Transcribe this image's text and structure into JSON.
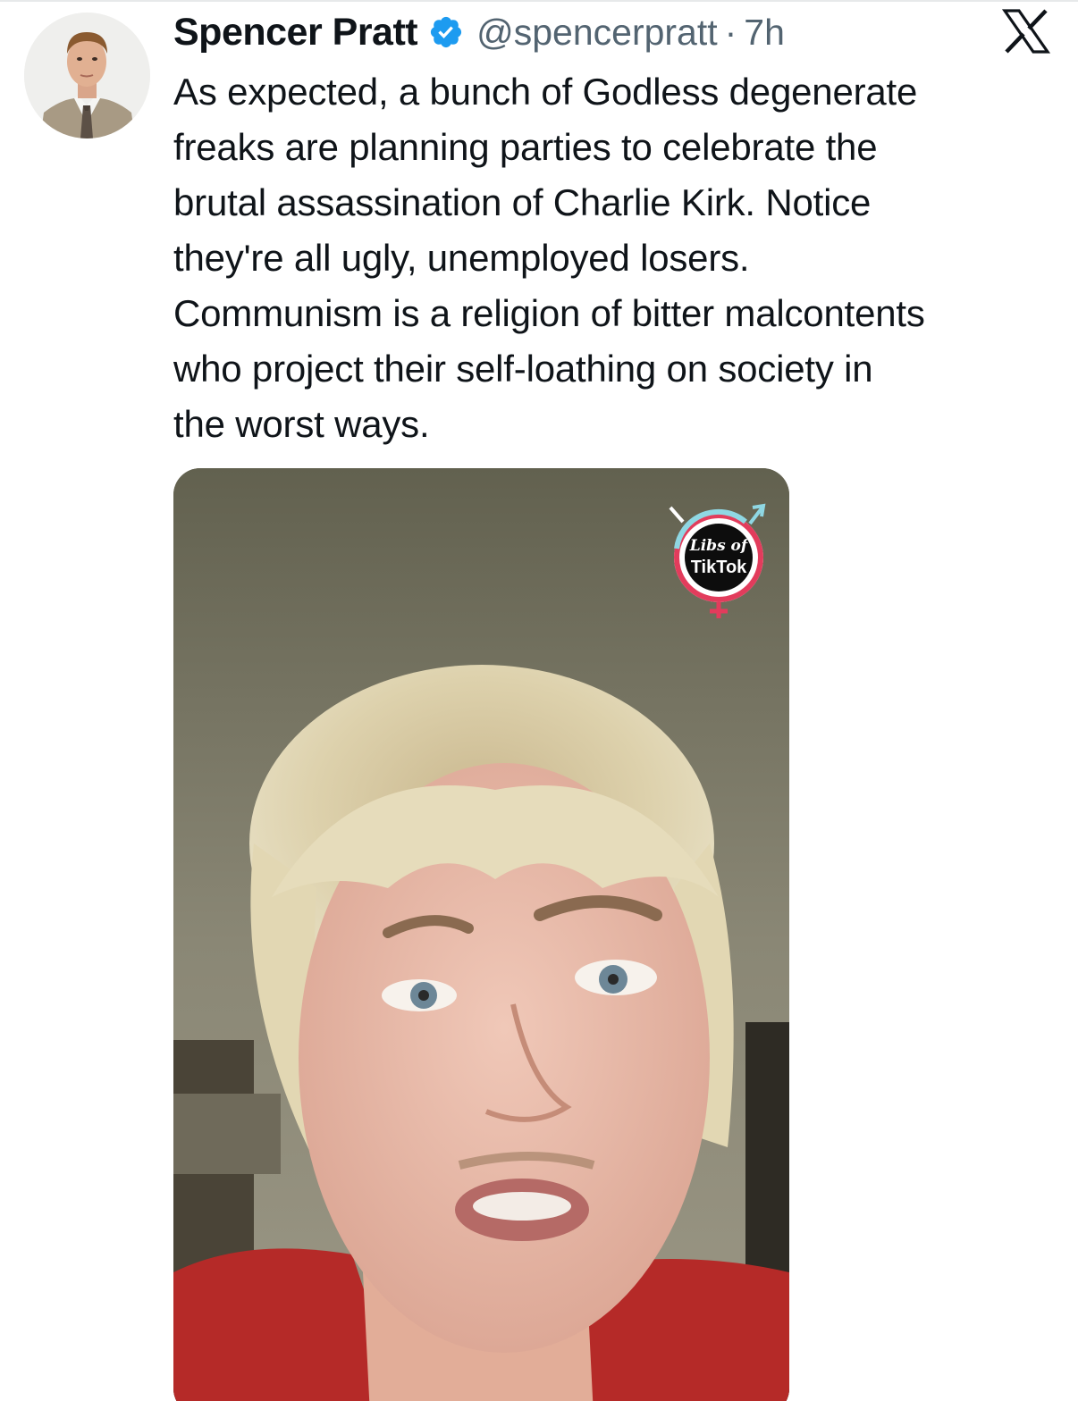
{
  "tweet": {
    "display_name": "Spencer Pratt",
    "handle": "@spencerpratt",
    "separator": "·",
    "time": "7h",
    "verified": true,
    "text_lines": [
      "As expected, a bunch of Godless degenerate",
      "freaks are planning parties to celebrate the",
      "brutal assassination of Charlie Kirk. Notice",
      "they're all ugly, unemployed losers.",
      "Communism is a religion of bitter malcontents",
      "who project their self-loathing on society in",
      "the worst ways."
    ]
  },
  "media": {
    "watermark_line1": "Libs of",
    "watermark_line2": "TikTok"
  },
  "icons": {
    "verified": "verified-badge-icon",
    "platform": "x-logo-icon"
  },
  "colors": {
    "verified_blue": "#1d9bf0",
    "text_primary": "#0f1419",
    "text_secondary": "#536471"
  }
}
